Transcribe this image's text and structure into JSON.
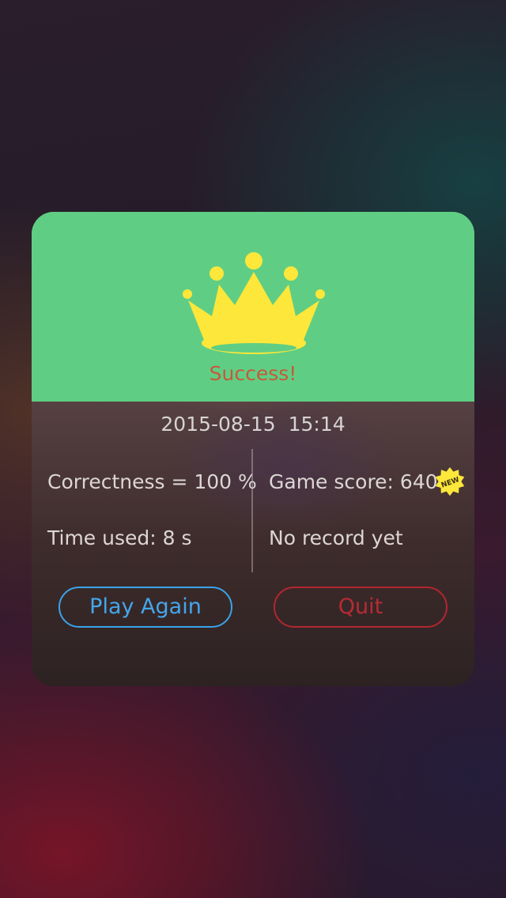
{
  "result": {
    "title": "Success!",
    "crown_icon": "crown-icon",
    "header_color": "#5fce84",
    "crown_color": "#fde73a",
    "title_color": "#c65a3c"
  },
  "session": {
    "date": "2015-08-15",
    "time": "15:14"
  },
  "stats": {
    "correctness": "Correctness = 100 %",
    "time_used": "Time used: 8 s",
    "game_score": "Game score: 640",
    "record": "No record yet",
    "new_badge": "NEW",
    "new_badge_icon": "new-badge-icon"
  },
  "actions": {
    "play_again": "Play Again",
    "quit": "Quit",
    "play_color": "#3aa3e8",
    "quit_color": "#b3262f"
  }
}
